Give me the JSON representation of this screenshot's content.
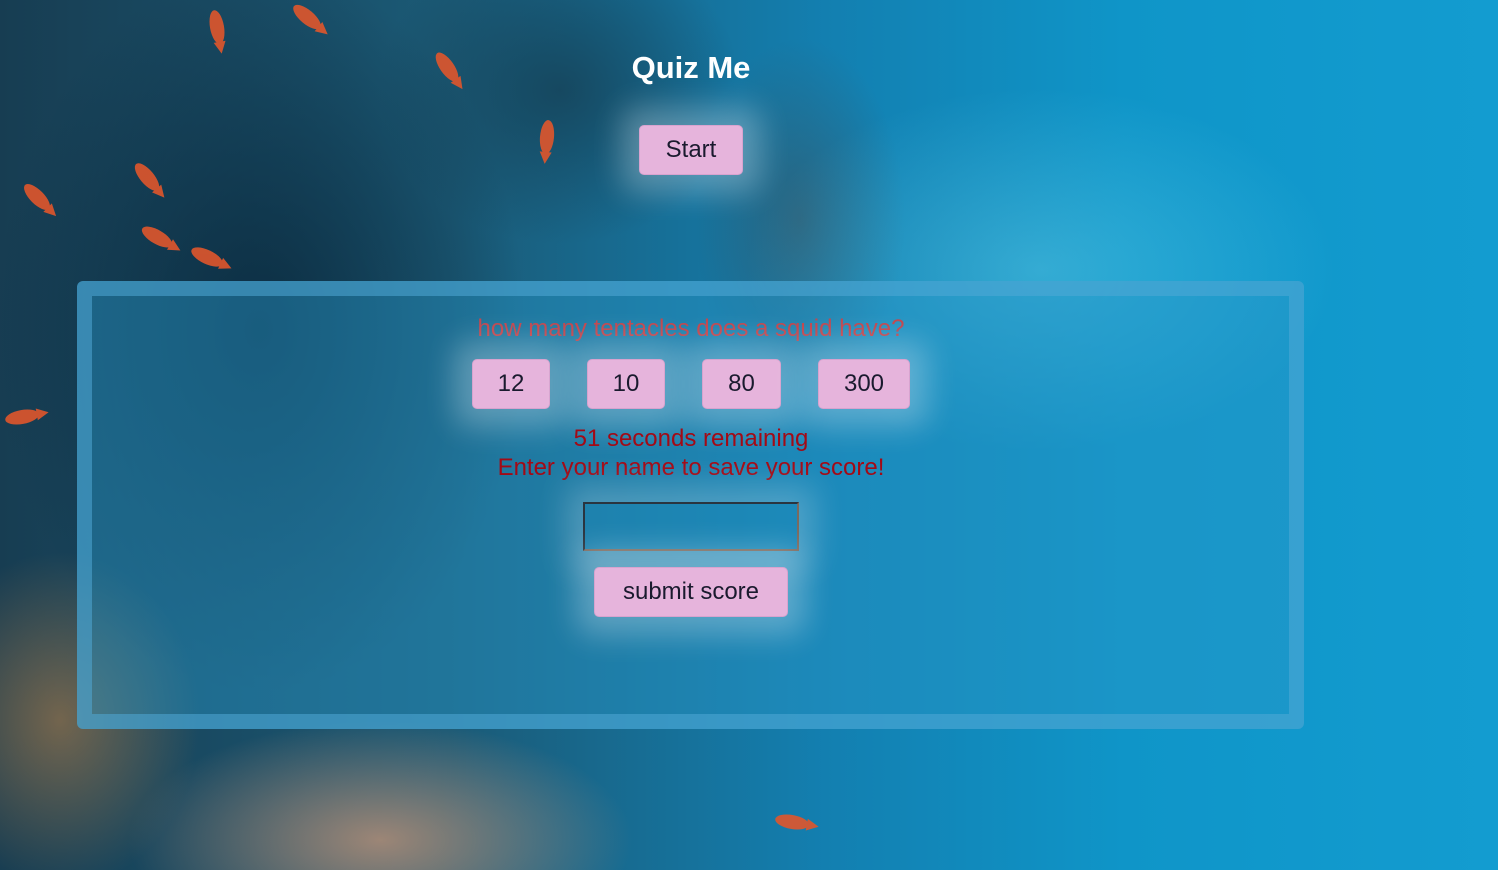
{
  "page": {
    "title": "Quiz Me"
  },
  "controls": {
    "start_label": "Start"
  },
  "quiz": {
    "question": "how many tentacles does a squid have?",
    "answers": [
      "12",
      "10",
      "80",
      "300"
    ],
    "timer_text": "51 seconds remaining",
    "name_prompt": "Enter your name to save your score!",
    "name_input_value": "",
    "submit_label": "submit score"
  },
  "colors": {
    "button_bg": "#e6b4dc",
    "question_text": "#c0464e",
    "status_text": "#a30a16",
    "title_text": "#ffffff"
  },
  "icons": {
    "background": "underwater-photo"
  }
}
